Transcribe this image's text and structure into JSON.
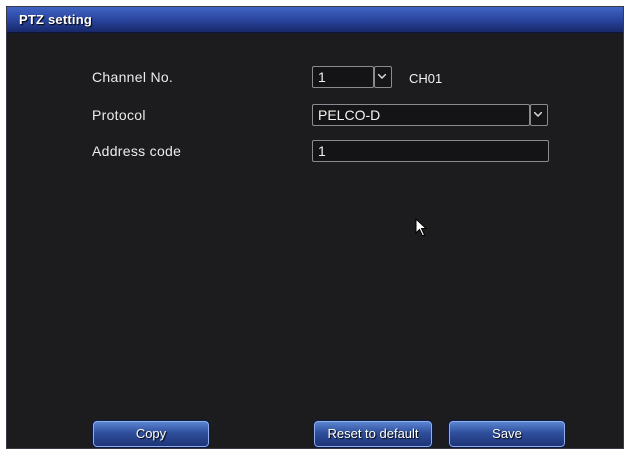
{
  "window": {
    "title": "PTZ setting"
  },
  "form": {
    "channel": {
      "label": "Channel No.",
      "value": "1",
      "channel_name": "CH01"
    },
    "protocol": {
      "label": "Protocol",
      "value": "PELCO-D"
    },
    "address": {
      "label": "Address code",
      "value": "1"
    }
  },
  "buttons": {
    "copy": "Copy",
    "reset": "Reset to default",
    "save": "Save"
  },
  "icons": {
    "dropdown": "chevron-down-icon",
    "cursor": "mouse-pointer-icon"
  },
  "colors": {
    "title_bar": "#2b46a0",
    "background": "#1c1c1e",
    "button": "#2f4f9c"
  }
}
